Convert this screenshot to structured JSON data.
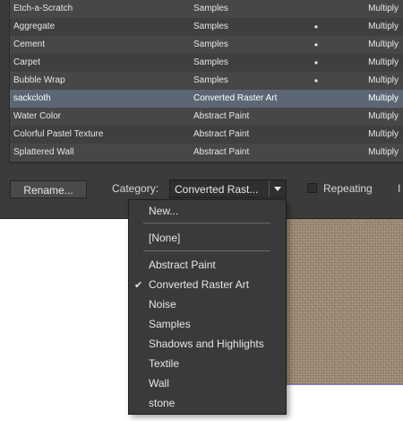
{
  "table": {
    "rows": [
      {
        "name": "Etch-a-Scratch",
        "category": "Samples",
        "dot": "",
        "blend": "Multiply"
      },
      {
        "name": "Aggregate",
        "category": "Samples",
        "dot": "•",
        "blend": "Multiply"
      },
      {
        "name": "Cement",
        "category": "Samples",
        "dot": "•",
        "blend": "Multiply"
      },
      {
        "name": "Carpet",
        "category": "Samples",
        "dot": "•",
        "blend": "Multiply"
      },
      {
        "name": "Bubble Wrap",
        "category": "Samples",
        "dot": "•",
        "blend": "Multiply"
      },
      {
        "name": "sackcloth",
        "category": "Converted Raster Art",
        "dot": "",
        "blend": "Multiply"
      },
      {
        "name": "Water Color",
        "category": "Abstract Paint",
        "dot": "",
        "blend": "Multiply"
      },
      {
        "name": "Colorful Pastel Texture",
        "category": "Abstract Paint",
        "dot": "",
        "blend": "Multiply"
      },
      {
        "name": "Splattered Wall",
        "category": "Abstract Paint",
        "dot": "",
        "blend": "Multiply"
      }
    ]
  },
  "controls": {
    "rename_label": "Rename...",
    "category_label": "Category:",
    "category_value": "Converted Rast...",
    "repeating_label": "Repeating",
    "edge_letter": "I"
  },
  "menu": {
    "new_label": "New...",
    "none_label": "[None]",
    "items": [
      {
        "label": "Abstract Paint"
      },
      {
        "label": "Converted Raster Art",
        "checked": true
      },
      {
        "label": "Noise"
      },
      {
        "label": "Samples"
      },
      {
        "label": "Shadows and Highlights"
      },
      {
        "label": "Textile"
      },
      {
        "label": "Wall"
      },
      {
        "label": "stone"
      }
    ],
    "check_glyph": "✔"
  }
}
